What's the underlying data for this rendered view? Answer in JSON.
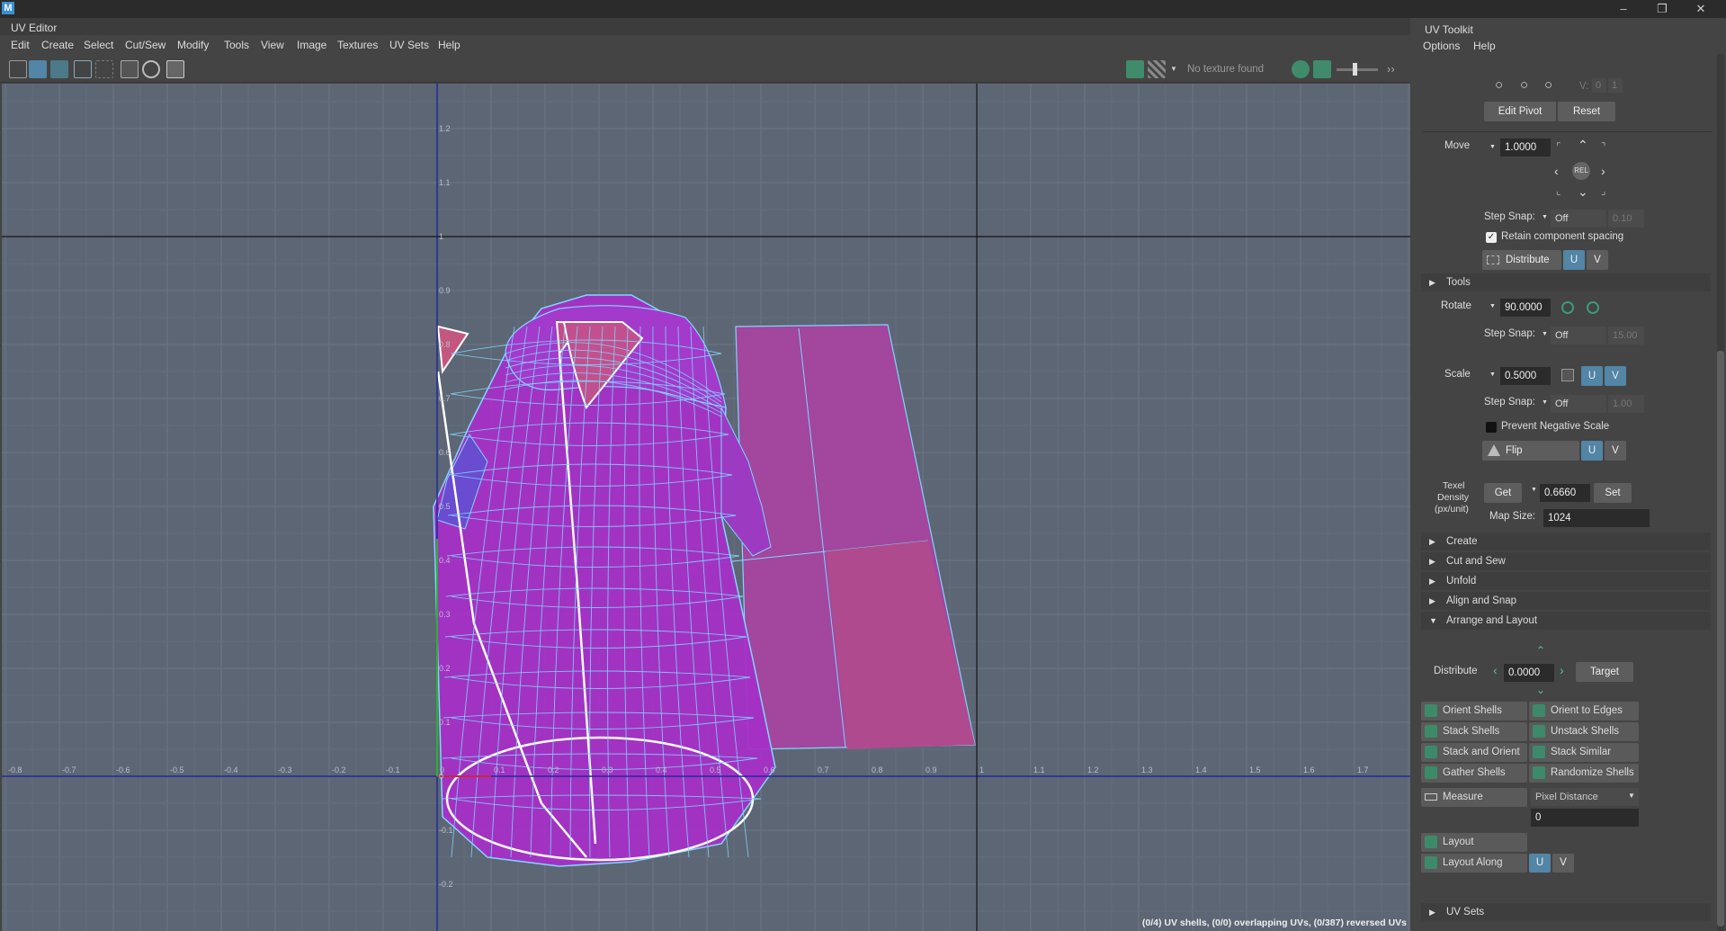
{
  "app": {
    "icon_letter": "M"
  },
  "editor": {
    "title": "UV Editor",
    "menus": [
      "Edit",
      "Create",
      "Select",
      "Cut/Sew",
      "Modify",
      "Tools",
      "View",
      "Image",
      "Textures",
      "UV Sets",
      "Help"
    ],
    "texture_status": "No texture found",
    "status_line": "(0/4) UV shells, (0/0) overlapping UVs, (0/387) reversed UVs"
  },
  "grid": {
    "x_ticks": [
      "-0.8",
      "-0.7",
      "-0.6",
      "-0.5",
      "-0.4",
      "-0.3",
      "-0.2",
      "-0.1",
      "0",
      "0.1",
      "0.2",
      "0.3",
      "0.4",
      "0.5",
      "0.6",
      "0.7",
      "0.8",
      "0.9",
      "1",
      "1.1",
      "1.2",
      "1.3",
      "1.4",
      "1.5",
      "1.6",
      "1.7"
    ],
    "y_ticks": [
      "1.2",
      "1.1",
      "1",
      "0.9",
      "0.8",
      "0.7",
      "0.6",
      "0.5",
      "0.4",
      "0.3",
      "0.2",
      "0.1",
      "0",
      "-0.1",
      "-0.2"
    ]
  },
  "toolkit": {
    "title": "UV Toolkit",
    "menus": [
      "Options",
      "Help"
    ],
    "v_label": "V:",
    "v_values": [
      "0",
      "1"
    ],
    "edit_pivot": "Edit Pivot",
    "reset": "Reset",
    "move_label": "Move",
    "move_value": "1.0000",
    "rel_label": "REL",
    "step_snap_label": "Step Snap:",
    "move_snap": "Off",
    "move_snap_value": "0.10",
    "retain_spacing": "Retain component spacing",
    "distribute_label": "Distribute",
    "u": "U",
    "v": "V",
    "tools_label": "Tools",
    "rotate_label": "Rotate",
    "rotate_value": "90.0000",
    "rotate_snap": "Off",
    "rotate_snap_value": "15.00",
    "scale_label": "Scale",
    "scale_value": "0.5000",
    "scale_snap": "Off",
    "scale_snap_value": "1.00",
    "prevent_negative": "Prevent Negative Scale",
    "flip_label": "Flip",
    "texel_label_1": "Texel",
    "texel_label_2": "Density",
    "texel_label_3": "(px/unit)",
    "get": "Get",
    "texel_value": "0.6660",
    "set": "Set",
    "map_size_label": "Map Size:",
    "map_size_value": "1024",
    "sections": [
      "Create",
      "Cut and Sew",
      "Unfold",
      "Align and Snap",
      "Arrange and Layout"
    ],
    "distribute2_label": "Distribute",
    "distribute2_value": "0.0000",
    "target": "Target",
    "shell_buttons": [
      "Orient Shells",
      "Orient to Edges",
      "Stack Shells",
      "Unstack Shells",
      "Stack and Orient",
      "Stack Similar",
      "Gather Shells",
      "Randomize Shells"
    ],
    "measure": "Measure",
    "measure_mode": "Pixel Distance",
    "measure_value": "0",
    "layout": "Layout",
    "layout_along": "Layout Along",
    "uv_sets": "UV Sets"
  }
}
